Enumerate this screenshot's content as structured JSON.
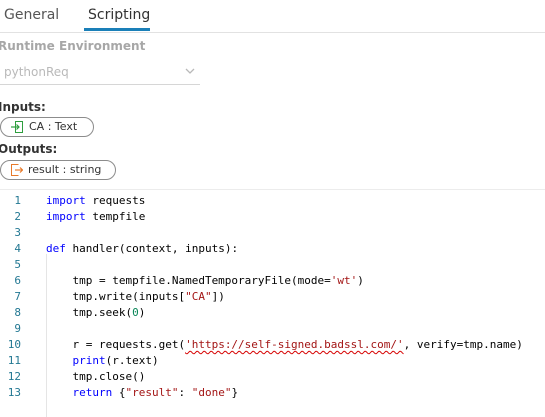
{
  "tabs": [
    {
      "label": "General"
    },
    {
      "label": "Scripting"
    }
  ],
  "runtime": {
    "label": "Runtime Environment",
    "value": "pythonReq"
  },
  "inputs": {
    "label": "Inputs:",
    "items": [
      {
        "text": "CA : Text",
        "icon": "input-arrow-icon"
      }
    ]
  },
  "outputs": {
    "label": "Outputs:",
    "items": [
      {
        "text": "result : string",
        "icon": "output-arrow-icon"
      }
    ]
  },
  "colors": {
    "accent": "#1a7fb8",
    "line_number": "#237893",
    "keyword": "#0000ff",
    "string": "#a31515",
    "number": "#098658",
    "input_icon": "#2e9e3e",
    "output_icon": "#e87a2a"
  },
  "code": {
    "lines": [
      {
        "num": "1",
        "parts": [
          {
            "t": "import",
            "c": "kw"
          },
          {
            "t": " requests",
            "c": ""
          }
        ]
      },
      {
        "num": "2",
        "parts": [
          {
            "t": "import",
            "c": "kw"
          },
          {
            "t": " tempfile",
            "c": ""
          }
        ]
      },
      {
        "num": "3",
        "parts": []
      },
      {
        "num": "4",
        "parts": [
          {
            "t": "def",
            "c": "kw"
          },
          {
            "t": " handler(context, inputs):",
            "c": ""
          }
        ]
      },
      {
        "num": "5",
        "parts": []
      },
      {
        "num": "6",
        "parts": [
          {
            "t": "    tmp = tempfile.NamedTemporaryFile(mode=",
            "c": ""
          },
          {
            "t": "'wt'",
            "c": "str"
          },
          {
            "t": ")",
            "c": ""
          }
        ]
      },
      {
        "num": "7",
        "parts": [
          {
            "t": "    tmp.write(inputs[",
            "c": ""
          },
          {
            "t": "\"CA\"",
            "c": "str"
          },
          {
            "t": "])",
            "c": ""
          }
        ]
      },
      {
        "num": "8",
        "parts": [
          {
            "t": "    tmp.seek(",
            "c": ""
          },
          {
            "t": "0",
            "c": "num"
          },
          {
            "t": ")",
            "c": ""
          }
        ]
      },
      {
        "num": "9",
        "parts": []
      },
      {
        "num": "10",
        "parts": [
          {
            "t": "    r = requests.get(",
            "c": ""
          },
          {
            "t": "'https://self-signed.badssl.com/'",
            "c": "str url-squiggle"
          },
          {
            "t": ", verify=tmp.name)",
            "c": ""
          }
        ]
      },
      {
        "num": "11",
        "parts": [
          {
            "t": "    ",
            "c": ""
          },
          {
            "t": "print",
            "c": "kw"
          },
          {
            "t": "(r.text)",
            "c": ""
          }
        ]
      },
      {
        "num": "12",
        "parts": [
          {
            "t": "    tmp.close()",
            "c": ""
          }
        ]
      },
      {
        "num": "13",
        "parts": [
          {
            "t": "    ",
            "c": ""
          },
          {
            "t": "return",
            "c": "kw"
          },
          {
            "t": " {",
            "c": ""
          },
          {
            "t": "\"result\"",
            "c": "str"
          },
          {
            "t": ": ",
            "c": ""
          },
          {
            "t": "\"done\"",
            "c": "str"
          },
          {
            "t": "}",
            "c": ""
          }
        ]
      }
    ]
  }
}
